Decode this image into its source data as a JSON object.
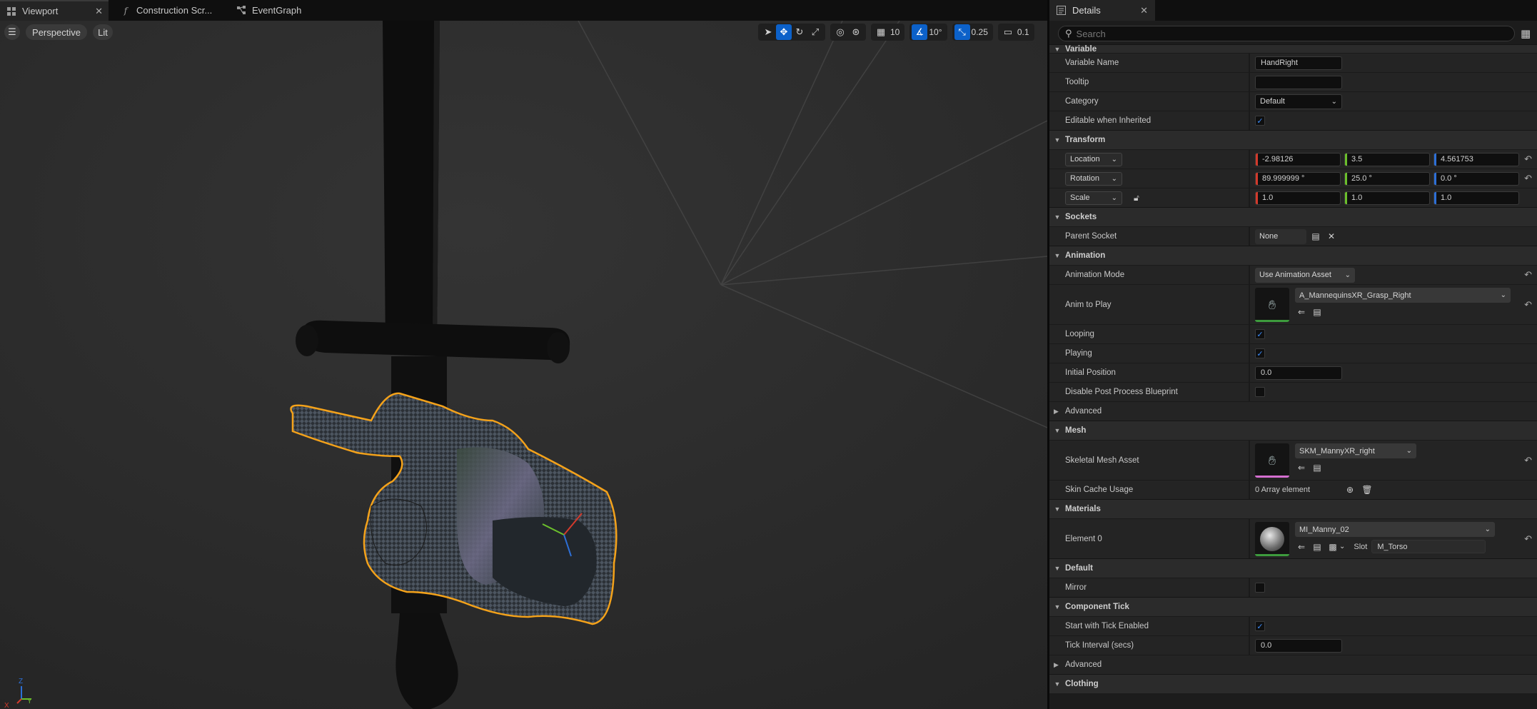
{
  "tabs": [
    {
      "label": "Viewport",
      "icon": "grid-icon",
      "active": true
    },
    {
      "label": "Construction Scr...",
      "icon": "function-icon"
    },
    {
      "label": "EventGraph",
      "icon": "graph-icon"
    }
  ],
  "viewport": {
    "perspective_label": "Perspective",
    "lit_label": "Lit",
    "grid_snap": "10",
    "rotation_snap": "10°",
    "scale_snap": "0.25",
    "camera_speed": "0.1",
    "axis": {
      "x": "X",
      "y": "Y",
      "z": "Z"
    }
  },
  "details": {
    "title": "Details",
    "search_placeholder": "Search",
    "variable": {
      "header": "Variable",
      "name_label": "Variable Name",
      "name_value": "HandRight",
      "tooltip_label": "Tooltip",
      "tooltip_value": "",
      "category_label": "Category",
      "category_value": "Default",
      "editable_label": "Editable when Inherited",
      "editable_checked": true
    },
    "transform": {
      "header": "Transform",
      "location_label": "Location",
      "location": [
        "-2.98126",
        "3.5",
        "4.561753"
      ],
      "rotation_label": "Rotation",
      "rotation": [
        "89.999999 °",
        "25.0 °",
        "0.0 °"
      ],
      "scale_label": "Scale",
      "scale": [
        "1.0",
        "1.0",
        "1.0"
      ]
    },
    "sockets": {
      "header": "Sockets",
      "parent_label": "Parent Socket",
      "parent_value": "None"
    },
    "animation": {
      "header": "Animation",
      "mode_label": "Animation Mode",
      "mode_value": "Use Animation Asset",
      "anim_label": "Anim to Play",
      "anim_value": "A_MannequinsXR_Grasp_Right",
      "looping_label": "Looping",
      "looping": true,
      "playing_label": "Playing",
      "playing": true,
      "initpos_label": "Initial Position",
      "initpos_value": "0.0",
      "disable_pp_label": "Disable Post Process Blueprint",
      "disable_pp": false,
      "advanced_label": "Advanced"
    },
    "mesh": {
      "header": "Mesh",
      "asset_label": "Skeletal Mesh Asset",
      "asset_value": "SKM_MannyXR_right",
      "skin_label": "Skin Cache Usage",
      "skin_value": "0 Array element"
    },
    "materials": {
      "header": "Materials",
      "element_label": "Element 0",
      "element_value": "MI_Manny_02",
      "slot_label": "Slot",
      "slot_value": "M_Torso"
    },
    "default": {
      "header": "Default",
      "mirror_label": "Mirror",
      "mirror": false
    },
    "tick": {
      "header": "Component Tick",
      "start_label": "Start with Tick Enabled",
      "start": true,
      "interval_label": "Tick Interval (secs)",
      "interval_value": "0.0",
      "advanced_label": "Advanced"
    },
    "clothing": {
      "header": "Clothing"
    }
  },
  "colors": {
    "accent": "#0c61c9",
    "selection_outline": "#f4a21a",
    "annotation_arrow": "#e0221f",
    "x_axis": "#d33a2c",
    "y_axis": "#6bbf2c",
    "z_axis": "#2d6fd6"
  }
}
